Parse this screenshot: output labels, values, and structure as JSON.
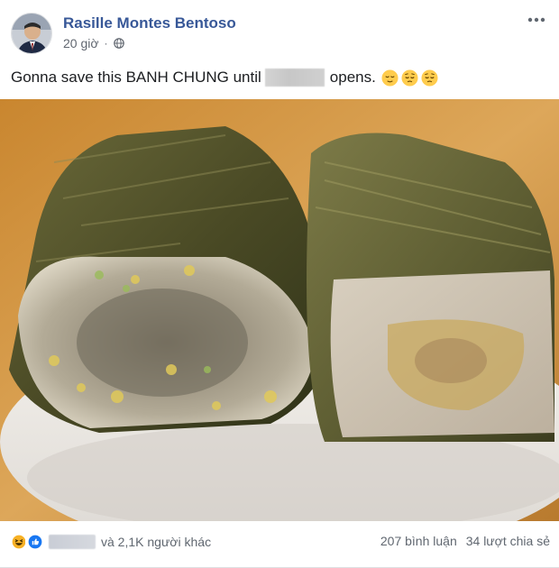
{
  "post": {
    "author": "Rasille Montes Bentoso",
    "time": "20 giờ",
    "caption_start": "Gonna save this BANH CHUNG until",
    "caption_end": "opens.",
    "emojis": [
      "relieved-face-emoji",
      "pensive-face-emoji",
      "pensive-face-emoji"
    ]
  },
  "footer": {
    "reactions": [
      "haha-reaction-icon",
      "like-reaction-icon"
    ],
    "others_text": "và 2,1K người khác",
    "comments": "207 bình luận",
    "shares": "34 lượt chia sẻ"
  },
  "colors": {
    "author_blue": "#385898",
    "meta_gray": "#616770",
    "like_blue": "#1877f2",
    "haha_yellow": "#f7b125"
  }
}
